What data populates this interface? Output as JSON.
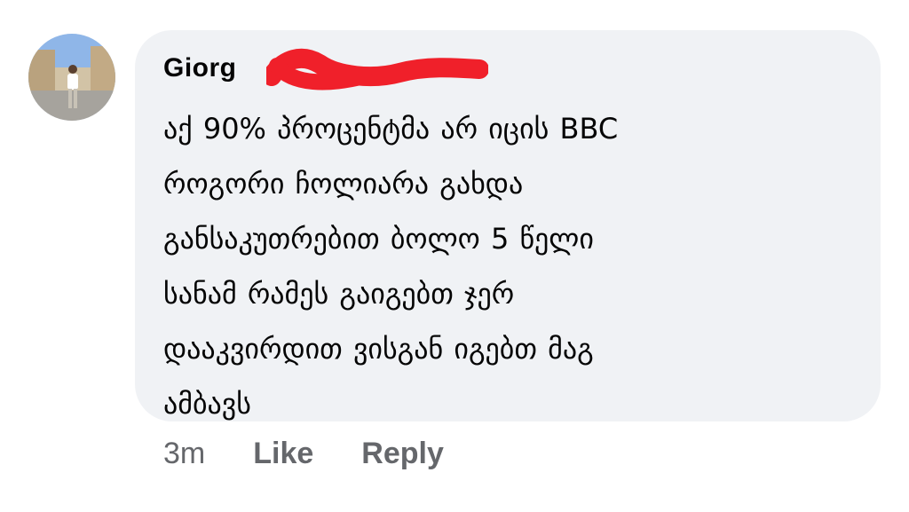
{
  "comment": {
    "author_visible": "Giorg",
    "text_lines": [
      "აქ 90% პროცენტმა არ იცის BBC",
      "როგორი ჩოლიარა გახდა",
      "განსაკუთრებით ბოლო 5 წელი",
      "სანამ რამეს გაიგებთ ჯერ",
      "დააკვირდით ვისგან იგებთ მაგ",
      "ამბავს"
    ],
    "redaction_color": "#f0202a"
  },
  "actions": {
    "timestamp": "3m",
    "like_label": "Like",
    "reply_label": "Reply"
  },
  "colors": {
    "bubble": "#f0f2f5",
    "text": "#050505",
    "meta": "#65676b"
  }
}
